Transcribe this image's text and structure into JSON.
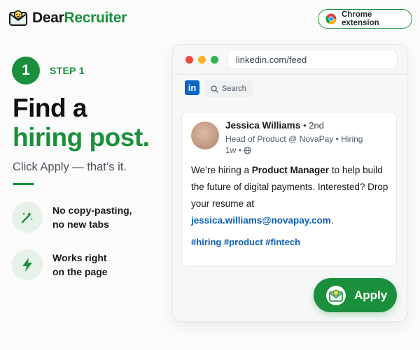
{
  "brand": {
    "part1": "Dear",
    "part2": "Recruiter"
  },
  "header": {
    "chrome_extension_label": "Chrome extension"
  },
  "step": {
    "number": "1",
    "label": "STEP 1"
  },
  "hero": {
    "title_line1": "Find a",
    "title_line2": "hiring post.",
    "subtitle": "Click Apply — that’s it."
  },
  "features": [
    {
      "line1": "No copy-pasting,",
      "line2": "no new tabs",
      "icon": "magic-wand-icon"
    },
    {
      "line1": "Works right",
      "line2": "on the page",
      "icon": "lightning-icon"
    }
  ],
  "browser": {
    "url": "linkedin.com/feed",
    "search_label": "Search",
    "li_logo": "in"
  },
  "post": {
    "author_name": "Jessica Williams",
    "connection": "• 2nd",
    "author_headline": "Head of Product @ NovaPay • Hiring",
    "time": "1w •",
    "body_part1": "We’re hiring a ",
    "body_bold": "Product Manager",
    "body_part2": " to help build the future of digital payments. Interested? Drop your resume at ",
    "email": "jessica.williams@novapay.com",
    "body_end": ".",
    "hashtags": "#hiring #product #fintech"
  },
  "apply": {
    "label": "Apply"
  },
  "colors": {
    "brand_green": "#1a8f3c",
    "linkedin_blue": "#0a66c2",
    "link_blue": "#0b5fb7"
  }
}
